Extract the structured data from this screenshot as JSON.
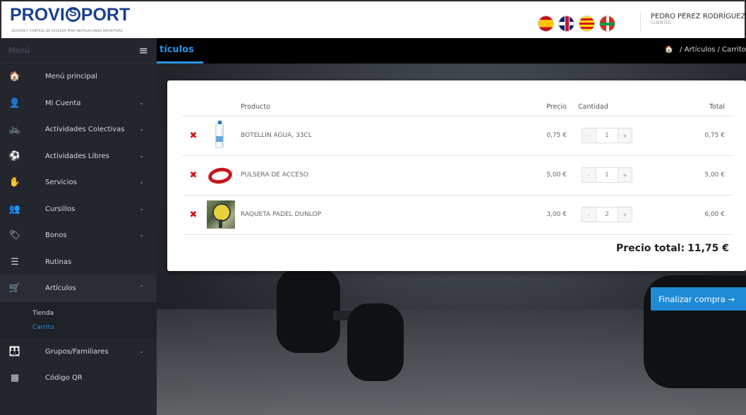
{
  "header": {
    "logo_text_a": "PROVI",
    "logo_text_b": "PORT",
    "tagline": "GESTIÓN Y CONTROL DE ACCESOS PARA INSTALACIONES DEPORTIVAS",
    "user_name": "PEDRO PÉREZ RODRÍGUEZ",
    "user_role": "CLIENTES",
    "languages": [
      "es",
      "en",
      "ca",
      "eu"
    ]
  },
  "sidebar": {
    "title": "Menú",
    "items": [
      {
        "label": "Menú principal",
        "icon": "home-icon",
        "glyph": "🏠"
      },
      {
        "label": "Mi Cuenta",
        "icon": "user-icon",
        "glyph": "👤",
        "chevron": "⌄"
      },
      {
        "label": "Actividades Colectivas",
        "icon": "bicycle-icon",
        "glyph": "🚲",
        "chevron": "⌄"
      },
      {
        "label": "Actividades Libres",
        "icon": "basketball-icon",
        "glyph": "⚽",
        "chevron": "⌄"
      },
      {
        "label": "Servicios",
        "icon": "service-icon",
        "glyph": "✋",
        "chevron": "⌄"
      },
      {
        "label": "Cursillos",
        "icon": "group-icon",
        "glyph": "👥",
        "chevron": "⌄"
      },
      {
        "label": "Bonos",
        "icon": "tags-icon",
        "glyph": "🏷",
        "chevron": "⌄"
      },
      {
        "label": "Rutinas",
        "icon": "list-icon",
        "glyph": "☰"
      },
      {
        "label": "Artículos",
        "icon": "cart-icon",
        "glyph": "🛒",
        "chevron": "⌃"
      }
    ],
    "submenu": [
      "Tienda",
      "Carrito"
    ],
    "items_after": [
      {
        "label": "Grupos/Familiares",
        "icon": "users-icon",
        "glyph": "👪",
        "chevron": "⌄"
      },
      {
        "label": "Código QR",
        "icon": "qrcode-icon",
        "glyph": "▦"
      }
    ]
  },
  "content_bar": {
    "title": "tículos",
    "breadcrumb": " / Artículos / Carrito"
  },
  "cart": {
    "columns": {
      "product": "Producto",
      "price": "Precio",
      "quantity": "Cantidad",
      "total": "Total"
    },
    "rows": [
      {
        "name": "BOTELLÍN AGUA, 33CL",
        "price": "0,75 €",
        "qty": "1",
        "total": "0,75 €",
        "image": "bottle"
      },
      {
        "name": "PULSERA DE ACCESO",
        "price": "5,00 €",
        "qty": "1",
        "total": "5,00 €",
        "image": "band"
      },
      {
        "name": "RAQUETA PADEL DUNLOP",
        "price": "3,00 €",
        "qty": "2",
        "total": "6,00 €",
        "image": "racket"
      }
    ],
    "minus": "-",
    "plus": "+",
    "delete_glyph": "✖",
    "total_label": "Precio total:",
    "total_value": "11,75 €"
  },
  "finish_button": "Finalizar compra →",
  "colors": {
    "accent": "#1f8ad6",
    "delete": "#d0161b",
    "logo": "#1b3f8f"
  }
}
